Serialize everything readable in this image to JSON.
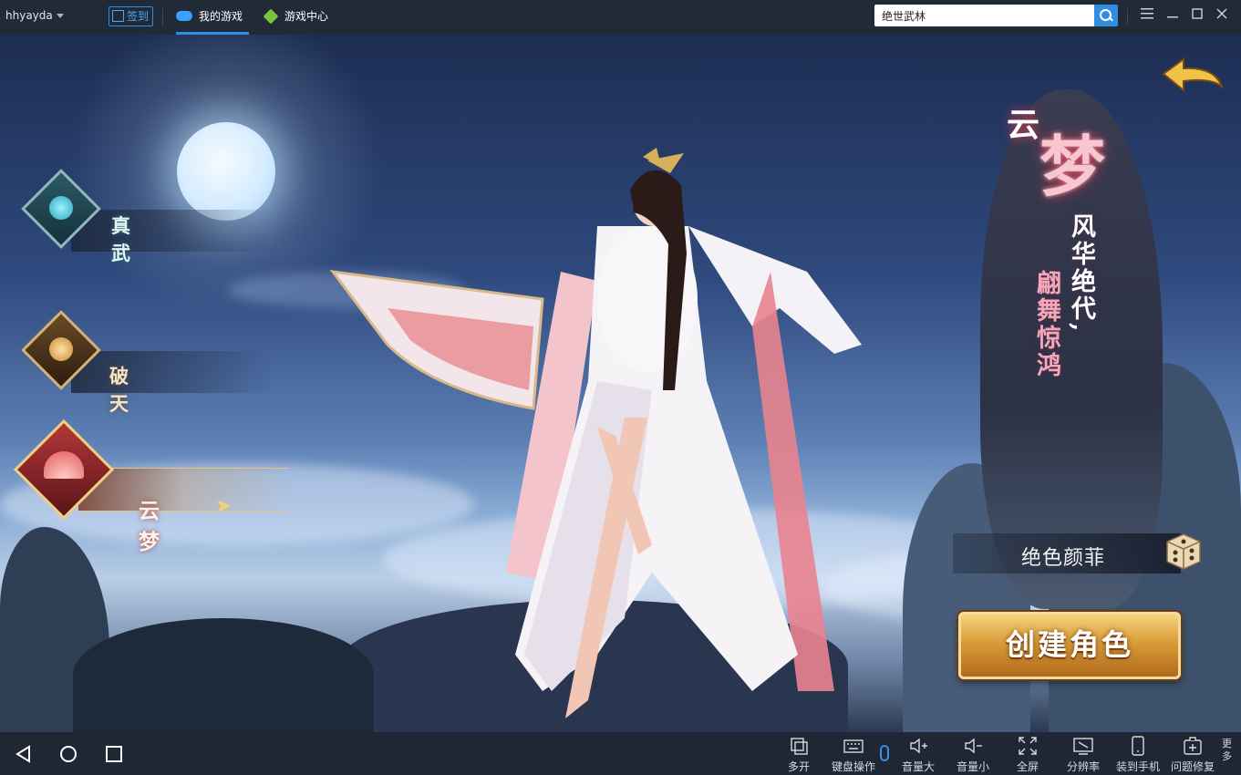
{
  "topbar": {
    "username": "hhyayda",
    "signin_label": "签到",
    "tabs": [
      {
        "label": "我的游戏",
        "active": true
      },
      {
        "label": "游戏中心",
        "active": false
      }
    ],
    "search_value": "绝世武林",
    "accent": "#2f8de4"
  },
  "game": {
    "classes": [
      {
        "name": "真武",
        "selected": false
      },
      {
        "name": "破天",
        "selected": false
      },
      {
        "name": "云梦",
        "selected": true
      }
    ],
    "title_small": "云",
    "title_big": "梦",
    "slogan_line1": "风华绝代,",
    "slogan_line2": "翩舞惊鸿",
    "character_name": "绝色颜菲",
    "create_button": "创建角色"
  },
  "bottombar": {
    "tools": [
      {
        "label": "多开",
        "icon": "multi-open-icon"
      },
      {
        "label": "键盘操作",
        "icon": "keyboard-icon"
      },
      {
        "label": "音量大",
        "icon": "volume-up-icon"
      },
      {
        "label": "音量小",
        "icon": "volume-down-icon"
      },
      {
        "label": "全屏",
        "icon": "fullscreen-icon"
      },
      {
        "label": "分辨率",
        "icon": "resolution-icon"
      },
      {
        "label": "装到手机",
        "icon": "install-to-phone-icon"
      },
      {
        "label": "问题修复",
        "icon": "repair-icon"
      }
    ],
    "more_label": "更多"
  }
}
